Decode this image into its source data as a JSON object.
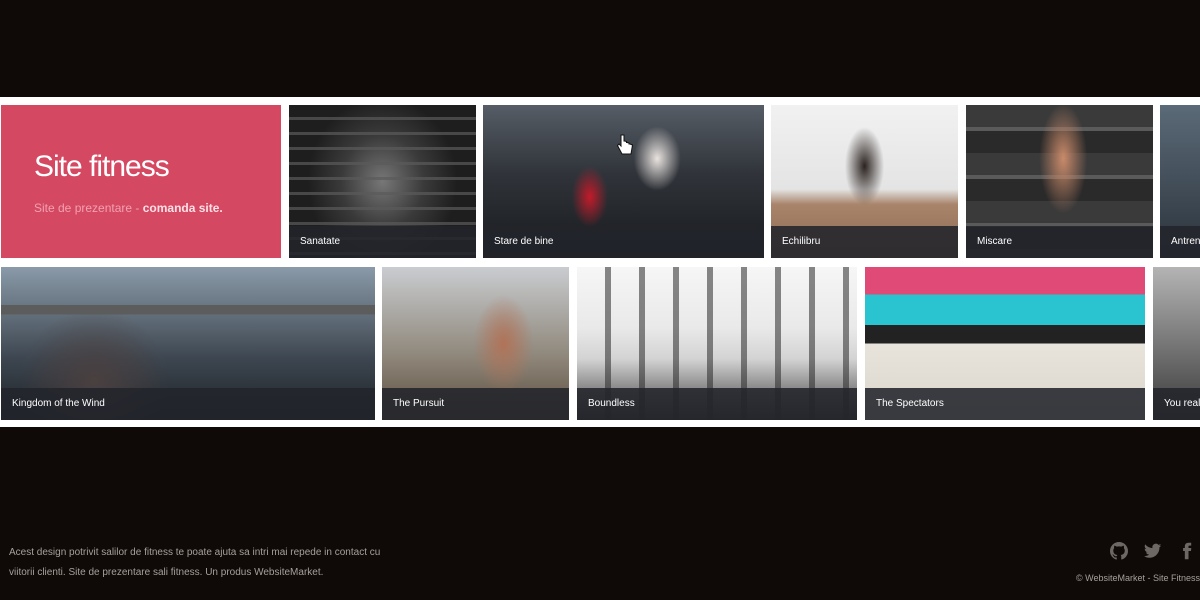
{
  "hero": {
    "title": "Site fitness",
    "subtitle_plain": "Site de prezentare - ",
    "subtitle_bold": "comanda site."
  },
  "gallery": {
    "row1": [
      {
        "caption": "Sanatate"
      },
      {
        "caption": "Stare de bine"
      },
      {
        "caption": "Echilibru"
      },
      {
        "caption": "Miscare"
      },
      {
        "caption": "Antrena"
      }
    ],
    "row2": [
      {
        "caption": "Kingdom of the Wind"
      },
      {
        "caption": "The Pursuit"
      },
      {
        "caption": "Boundless"
      },
      {
        "caption": "The Spectators"
      },
      {
        "caption": "You really"
      }
    ]
  },
  "footer": {
    "description": "Acest design potrivit salilor de fitness te poate ajuta sa intri mai repede in contact cu viitorii clienti. Site de prezentare sali fitness. Un produs WebsiteMarket.",
    "copyright": "© WebsiteMarket - Site Fitness",
    "social_icons": [
      "github-icon",
      "twitter-icon",
      "facebook-icon"
    ]
  },
  "colors": {
    "background": "#0f0a07",
    "hero": "#d44862",
    "caption_bar": "#22242b",
    "footer_text": "#a5a09b"
  }
}
